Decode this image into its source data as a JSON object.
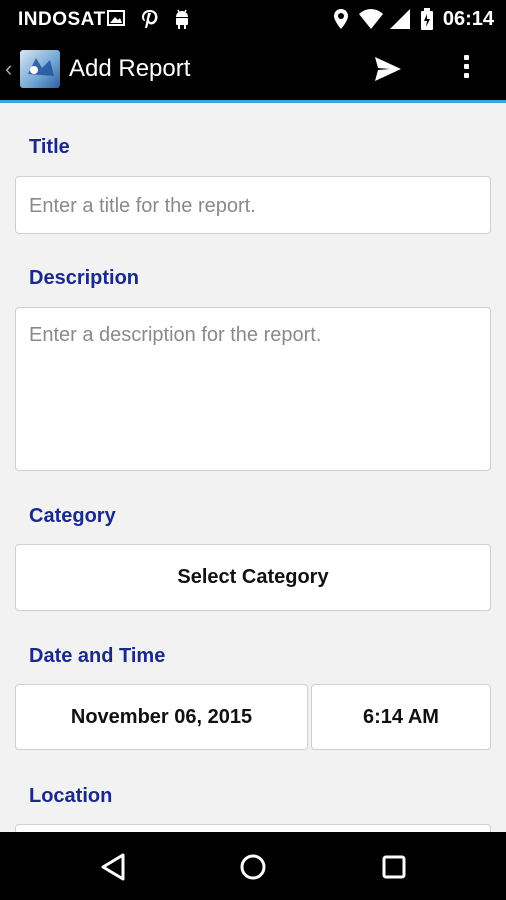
{
  "status_bar": {
    "carrier": "INDOSAT",
    "time": "06:14",
    "icons": [
      "image-icon",
      "pinterest-icon",
      "android-icon",
      "location-icon",
      "wifi-icon",
      "signal-icon",
      "battery-icon"
    ]
  },
  "action_bar": {
    "title": "Add Report",
    "icons": [
      "back-chevron-icon",
      "app-logo",
      "send-icon",
      "overflow-menu-icon"
    ]
  },
  "form": {
    "title_label": "Title",
    "title_placeholder": "Enter a title for the report.",
    "description_label": "Description",
    "description_placeholder": "Enter a description for the report.",
    "category_label": "Category",
    "category_button": "Select Category",
    "datetime_label": "Date and Time",
    "date_value": "November 06, 2015",
    "time_value": "6:14 AM",
    "location_label": "Location"
  },
  "nav_bar": {
    "icons": [
      "back-triangle-icon",
      "home-circle-icon",
      "recents-square-icon"
    ]
  },
  "colors": {
    "label_blue": "#1a2a8c",
    "accent": "#3aa6e0",
    "bar_background": "#000000",
    "content_background": "#f2f2f2"
  }
}
